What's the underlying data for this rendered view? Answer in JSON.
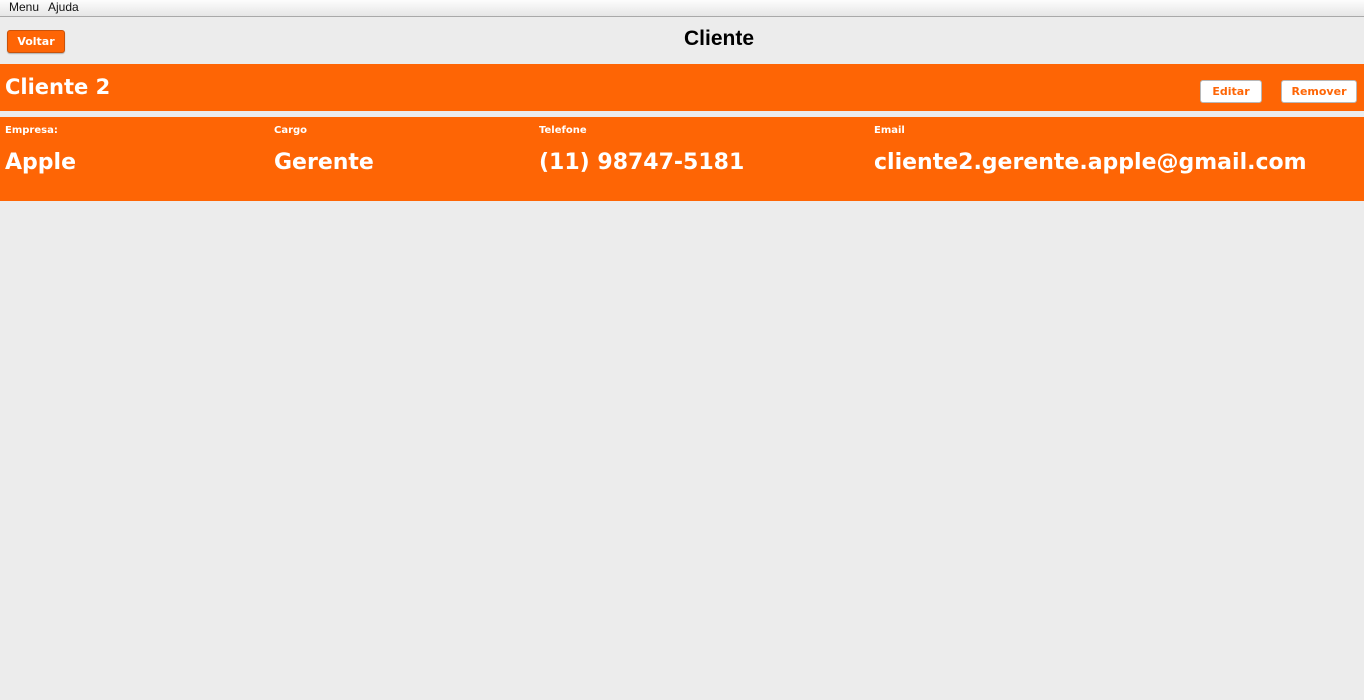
{
  "menubar": {
    "items": [
      "Menu",
      "Ajuda"
    ]
  },
  "header": {
    "back_label": "Voltar",
    "title": "Cliente"
  },
  "client": {
    "name": "Cliente 2",
    "edit_label": "Editar",
    "remove_label": "Remover",
    "fields": {
      "empresa": {
        "label": "Empresa:",
        "value": "Apple"
      },
      "cargo": {
        "label": "Cargo",
        "value": "Gerente"
      },
      "telefone": {
        "label": "Telefone",
        "value": "(11) 98747-5181"
      },
      "email": {
        "label": "Email",
        "value": "cliente2.gerente.apple@gmail.com"
      }
    }
  },
  "colors": {
    "accent": "#fe6505",
    "background": "#ececec"
  }
}
